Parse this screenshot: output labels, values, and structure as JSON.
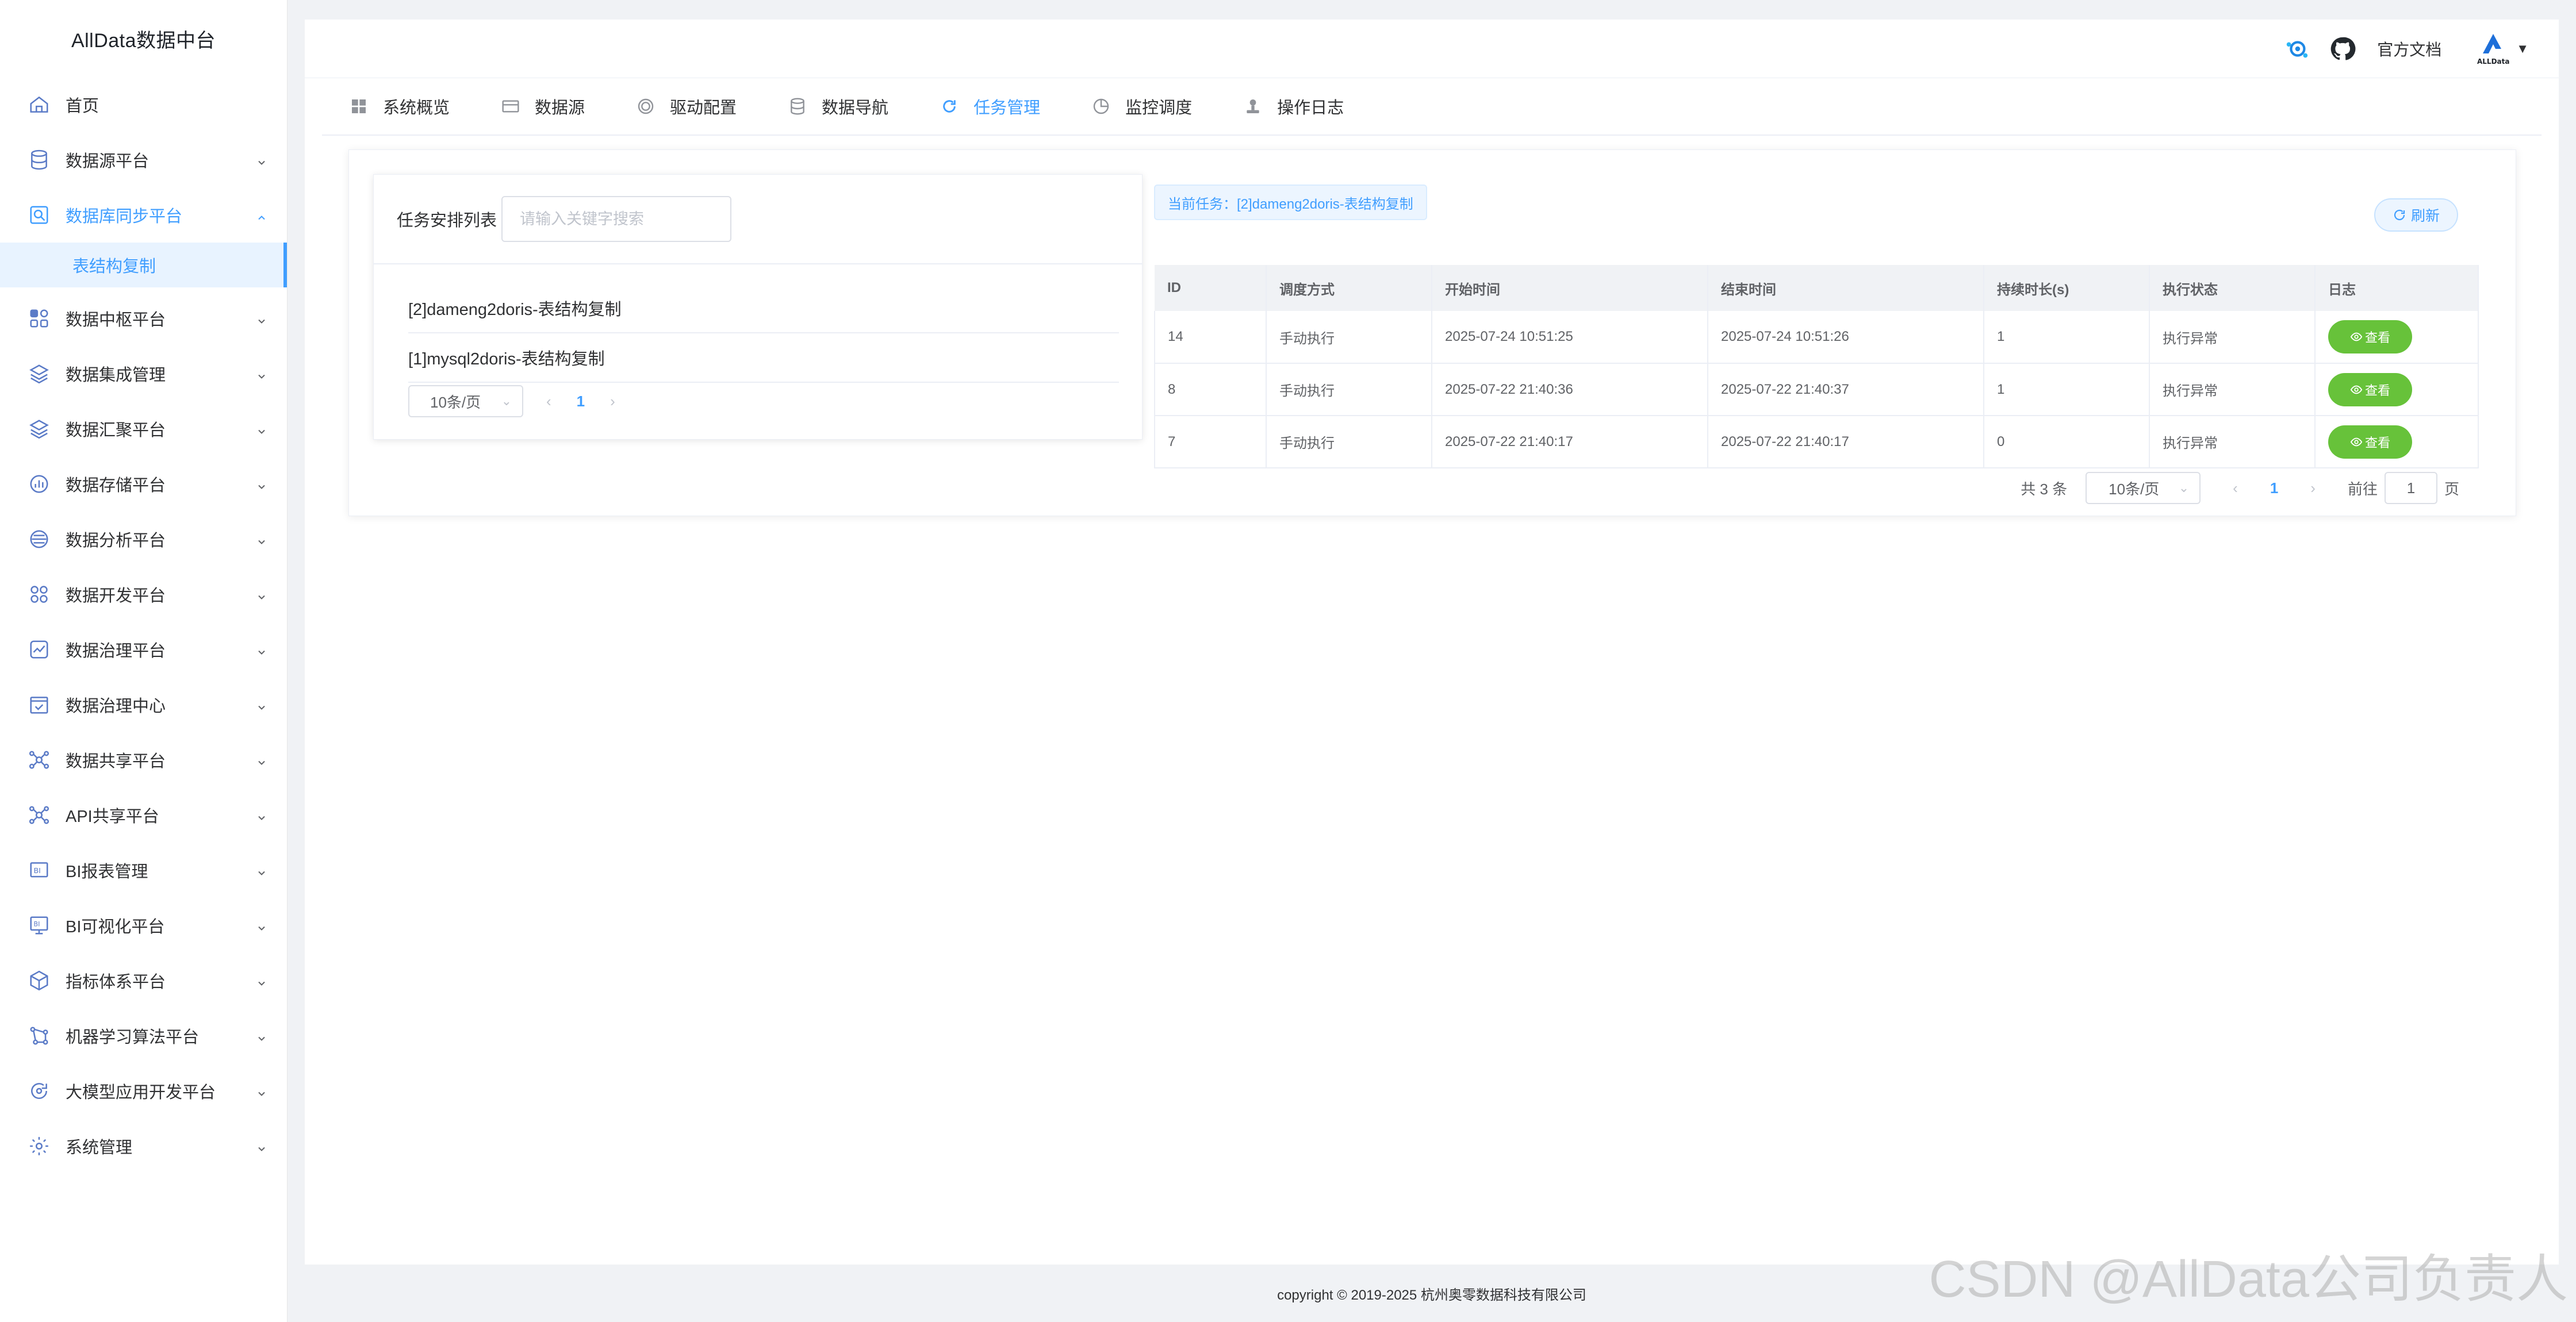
{
  "brand": "AllData数据中台",
  "sidebar": {
    "items": [
      {
        "label": "首页",
        "icon": "home-icon",
        "has_children": false
      },
      {
        "label": "数据源平台",
        "icon": "database-icon",
        "has_children": true
      },
      {
        "label": "数据库同步平台",
        "icon": "search-sync-icon",
        "has_children": true,
        "open": true
      },
      {
        "label": "数据中枢平台",
        "icon": "grid-icon",
        "has_children": true
      },
      {
        "label": "数据集成管理",
        "icon": "layers-icon",
        "has_children": true
      },
      {
        "label": "数据汇聚平台",
        "icon": "layers-icon",
        "has_children": true
      },
      {
        "label": "数据存储平台",
        "icon": "bar-chart-icon",
        "has_children": true
      },
      {
        "label": "数据分析平台",
        "icon": "analysis-icon",
        "has_children": true
      },
      {
        "label": "数据开发平台",
        "icon": "nodes-icon",
        "has_children": true
      },
      {
        "label": "数据治理平台",
        "icon": "trend-icon",
        "has_children": true
      },
      {
        "label": "数据治理中心",
        "icon": "calendar-check-icon",
        "has_children": true
      },
      {
        "label": "数据共享平台",
        "icon": "share-network-icon",
        "has_children": true
      },
      {
        "label": "API共享平台",
        "icon": "api-network-icon",
        "has_children": true
      },
      {
        "label": "BI报表管理",
        "icon": "bi-report-icon",
        "has_children": true
      },
      {
        "label": "BI可视化平台",
        "icon": "bi-monitor-icon",
        "has_children": true
      },
      {
        "label": "指标体系平台",
        "icon": "cube-icon",
        "has_children": true
      },
      {
        "label": "机器学习算法平台",
        "icon": "ml-icon",
        "has_children": true
      },
      {
        "label": "大模型应用开发平台",
        "icon": "refresh-circle-icon",
        "has_children": true
      },
      {
        "label": "系统管理",
        "icon": "gear-icon",
        "has_children": true
      }
    ],
    "sub_item": "表结构复制"
  },
  "topbar": {
    "doc_label": "官方文档",
    "caret": "▼"
  },
  "tabs": [
    {
      "label": "系统概览",
      "icon": "grid-four-icon"
    },
    {
      "label": "数据源",
      "icon": "card-icon"
    },
    {
      "label": "驱动配置",
      "icon": "driver-circle-icon"
    },
    {
      "label": "数据导航",
      "icon": "database-stack-icon"
    },
    {
      "label": "任务管理",
      "icon": "task-refresh-icon",
      "active": true
    },
    {
      "label": "监控调度",
      "icon": "pie-icon"
    },
    {
      "label": "操作日志",
      "icon": "user-stamp-icon"
    }
  ],
  "left_panel": {
    "title": "任务安排列表",
    "search_placeholder": "请输入关键字搜索",
    "tasks": [
      "[2]dameng2doris-表结构复制",
      "[1]mysql2doris-表结构复制"
    ],
    "page_size": "10条/页",
    "prev": "‹",
    "page": "1",
    "next": "›"
  },
  "right_panel": {
    "current_task": "当前任务：[2]dameng2doris-表结构复制",
    "refresh_label": "刷新",
    "columns": [
      "ID",
      "调度方式",
      "开始时间",
      "结束时间",
      "持续时长(s)",
      "执行状态",
      "日志"
    ],
    "rows": [
      {
        "id": "14",
        "mode": "手动执行",
        "start": "2025-07-24 10:51:25",
        "end": "2025-07-24 10:51:26",
        "duration": "1",
        "status": "执行异常",
        "log": "查看"
      },
      {
        "id": "8",
        "mode": "手动执行",
        "start": "2025-07-22 21:40:36",
        "end": "2025-07-22 21:40:37",
        "duration": "1",
        "status": "执行异常",
        "log": "查看"
      },
      {
        "id": "7",
        "mode": "手动执行",
        "start": "2025-07-22 21:40:17",
        "end": "2025-07-22 21:40:17",
        "duration": "0",
        "status": "执行异常",
        "log": "查看"
      }
    ],
    "pager": {
      "total": "共 3 条",
      "page_size": "10条/页",
      "prev": "‹",
      "page": "1",
      "next": "›",
      "goto_label": "前往",
      "goto_value": "1",
      "page_suffix": "页"
    }
  },
  "footer": "copyright © 2019-2025 杭州奥零数据科技有限公司",
  "watermark": "CSDN @AllData公司负责人",
  "colors": {
    "primary": "#409eff",
    "success": "#67c23a",
    "sidebar_icon": "#5b7bc7"
  }
}
